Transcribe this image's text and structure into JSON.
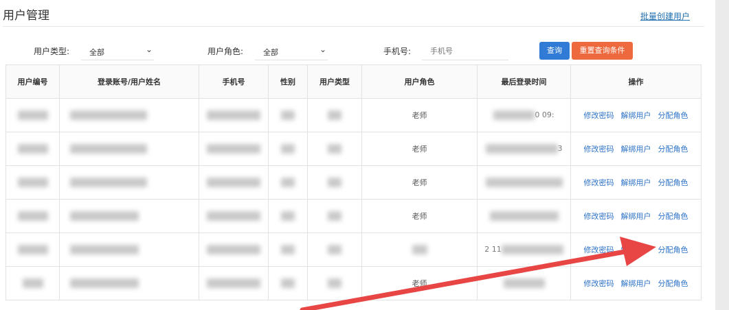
{
  "page": {
    "title": "用户管理",
    "batch_create_link": "批量创建用户"
  },
  "filters": {
    "user_type_label": "用户类型:",
    "user_type_value": "全部",
    "user_role_label": "用户角色:",
    "user_role_value": "全部",
    "phone_label": "手机号:",
    "phone_placeholder": "手机号",
    "query_button": "查询",
    "reset_button": "重置查询条件"
  },
  "table": {
    "headers": [
      "用户编号",
      "登录账号/用户姓名",
      "手机号",
      "性别",
      "用户类型",
      "用户角色",
      "最后登录时间",
      "操作"
    ],
    "rows": [
      {
        "role": "老师",
        "last_login_visible": "0 09:"
      },
      {
        "role": "老师",
        "last_login_visible": "3"
      },
      {
        "role": "老师",
        "last_login_visible": ""
      },
      {
        "role": "老师",
        "last_login_visible": ""
      },
      {
        "role": "",
        "last_login_visible": "2 11"
      },
      {
        "role": "老师",
        "last_login_visible": ""
      }
    ],
    "actions": {
      "change_password": "修改密码",
      "unbind_user": "解绑用户",
      "assign_role": "分配角色"
    }
  },
  "colors": {
    "link_blue": "#2c72c7",
    "query_button": "#2f7bd6",
    "reset_button": "#ee6a3e",
    "annotation_arrow": "#e84545"
  },
  "annotation": {
    "type": "arrow",
    "points_to": "分配角色"
  }
}
